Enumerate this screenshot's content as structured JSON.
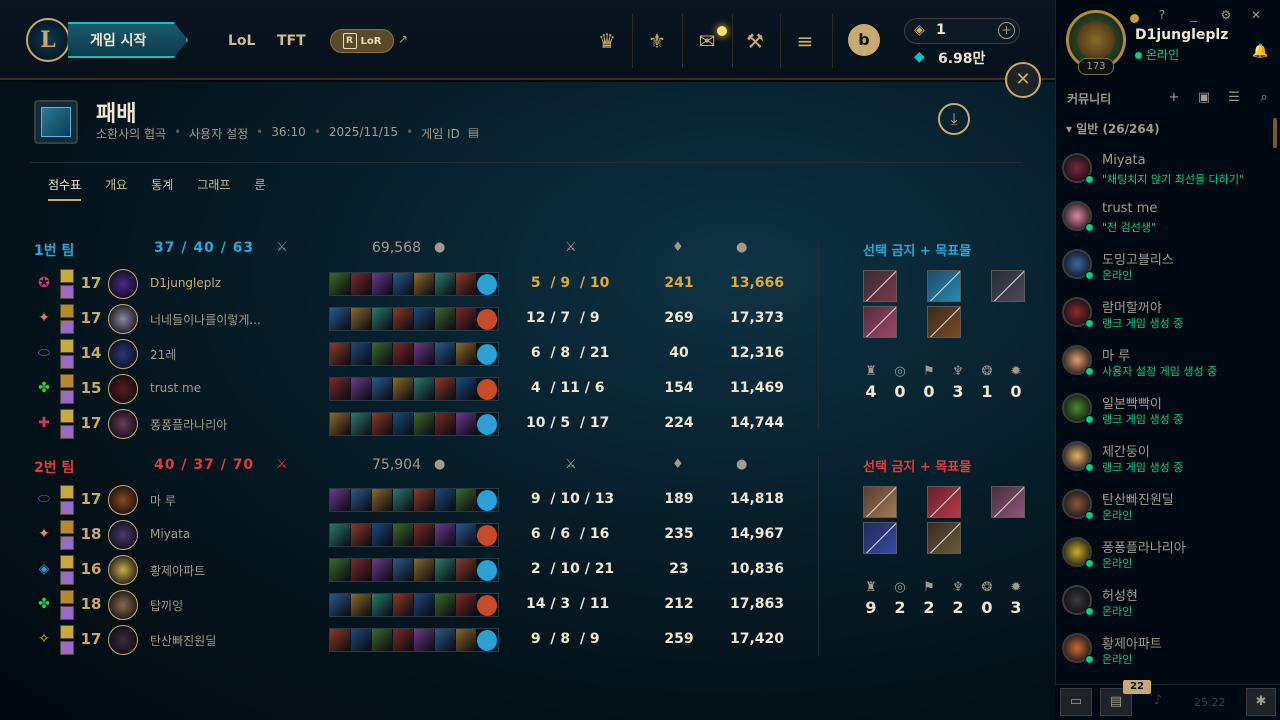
{
  "topbar": {
    "play_label": "게임 시작",
    "nav": [
      "LoL",
      "TFT"
    ],
    "lor_label": "LoR",
    "currency_rp": "1",
    "currency_be": "6.98만",
    "store_label": "b"
  },
  "header": {
    "result": "패배",
    "meta": [
      "소환사의 협곡",
      "사용자 설정",
      "36:10",
      "2025/11/15",
      "게임 ID"
    ]
  },
  "tabs": [
    "점수표",
    "개요",
    "통계",
    "그래프",
    "룬"
  ],
  "teams": [
    {
      "name": "1번 팀",
      "kda": "37 / 40 / 63",
      "gold": "69,568",
      "color": "#26a9d6",
      "bans_title": "선택 금지 + 목표물",
      "objectives": [
        "4",
        "0",
        "0",
        "3",
        "1",
        "0"
      ],
      "players": [
        {
          "level": "17",
          "name": "D1jungleplz",
          "kda": " 5  / 9  / 10",
          "cs": "241",
          "gold": "13,666",
          "self": true
        },
        {
          "level": "17",
          "name": "너네들이나를이렇게...",
          "kda": "12 / 7  / 9",
          "cs": "269",
          "gold": "17,373",
          "self": false
        },
        {
          "level": "14",
          "name": "21레",
          "kda": " 6  / 8  / 21",
          "cs": "40",
          "gold": "12,316",
          "self": false
        },
        {
          "level": "15",
          "name": "trust me",
          "kda": " 4  / 11 / 6",
          "cs": "154",
          "gold": "11,469",
          "self": false
        },
        {
          "level": "17",
          "name": "퐁퐁플라나리아",
          "kda": "10 / 5  / 17",
          "cs": "224",
          "gold": "14,744",
          "self": false
        }
      ]
    },
    {
      "name": "2번 팀",
      "kda": "40 / 37 / 70",
      "gold": "75,904",
      "color": "#e23b3b",
      "bans_title": "선택 금지 + 목표물",
      "objectives": [
        "9",
        "2",
        "2",
        "2",
        "0",
        "3"
      ],
      "players": [
        {
          "level": "17",
          "name": "마 루",
          "kda": " 9  / 10 / 13",
          "cs": "189",
          "gold": "14,818",
          "self": false
        },
        {
          "level": "18",
          "name": "Miyata",
          "kda": " 6  / 6  / 16",
          "cs": "235",
          "gold": "14,967",
          "self": false
        },
        {
          "level": "16",
          "name": "황제아파트",
          "kda": " 2  / 10 / 21",
          "cs": "23",
          "gold": "10,836",
          "self": false
        },
        {
          "level": "18",
          "name": "탑끼잉",
          "kda": "14 / 3  / 11",
          "cs": "212",
          "gold": "17,863",
          "self": false
        },
        {
          "level": "17",
          "name": "탄산빠진원딜",
          "kda": " 9  / 8  / 9",
          "cs": "259",
          "gold": "17,420",
          "self": false
        }
      ]
    }
  ],
  "profile": {
    "name": "D1jungleplz",
    "status": "온라인",
    "level": "173"
  },
  "community": {
    "title": "커뮤니티",
    "group": "일반 (26/264)",
    "friends": [
      {
        "name": "Miyata",
        "status": "\"채팅치지 않기 최선을 다하기\""
      },
      {
        "name": "trust me",
        "status": "\"전 검선생\""
      },
      {
        "name": "도밍고블리스",
        "status": "온라인"
      },
      {
        "name": "람머할꺼야",
        "status": "랭크 게임 생성 중"
      },
      {
        "name": "마 루",
        "status": "사용자 설정 게임 생성 중"
      },
      {
        "name": "일본빡빡이",
        "status": "랭크 게임 생성 중"
      },
      {
        "name": "제간둥이",
        "status": "랭크 게임 생성 중"
      },
      {
        "name": "탄산빠진원딜",
        "status": "온라인"
      },
      {
        "name": "퐁퐁플라나리아",
        "status": "온라인"
      },
      {
        "name": "허성현",
        "status": "온라인"
      },
      {
        "name": "황제아파트",
        "status": "온라인"
      }
    ]
  },
  "bottom": {
    "badge": "22",
    "version": "25.22"
  },
  "icons": {
    "close": "close-icon",
    "download": "download-icon",
    "cs": "minion-icon",
    "gold": "gold-coins-icon",
    "kda": "crossed-swords-icon"
  }
}
